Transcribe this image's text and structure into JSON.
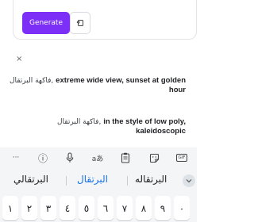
{
  "prompt_card": {
    "generate_label": "Generate"
  },
  "close_label": "×",
  "suggestions": [
    {
      "prefix": "فاكهة البرتقال,",
      "bold": "extreme wide view, sunset at golden hour"
    },
    {
      "prefix": "فاكهة البرتقال,",
      "bold": "in the style of low poly, kaleidoscopic"
    }
  ],
  "keyboard": {
    "toolbar_icons": [
      "more-icon",
      "info-icon",
      "mic-icon",
      "translate-icon",
      "clipboard-icon",
      "sticker-icon",
      "gif-icon"
    ],
    "more_label": "···",
    "info_label": "ⓘ",
    "translate_label": "aあ",
    "gif_label": "GIF",
    "candidates": [
      "البرتقالي",
      "البرتقال",
      "البرتقاله"
    ],
    "digits": [
      "١",
      "٢",
      "٣",
      "٤",
      "٥",
      "٦",
      "٧",
      "٨",
      "٩",
      "٠"
    ]
  },
  "colors": {
    "accent": "#7b2ff7",
    "candidate_selected": "#1a73e8",
    "keyboard_bg": "#f3f5f7"
  }
}
